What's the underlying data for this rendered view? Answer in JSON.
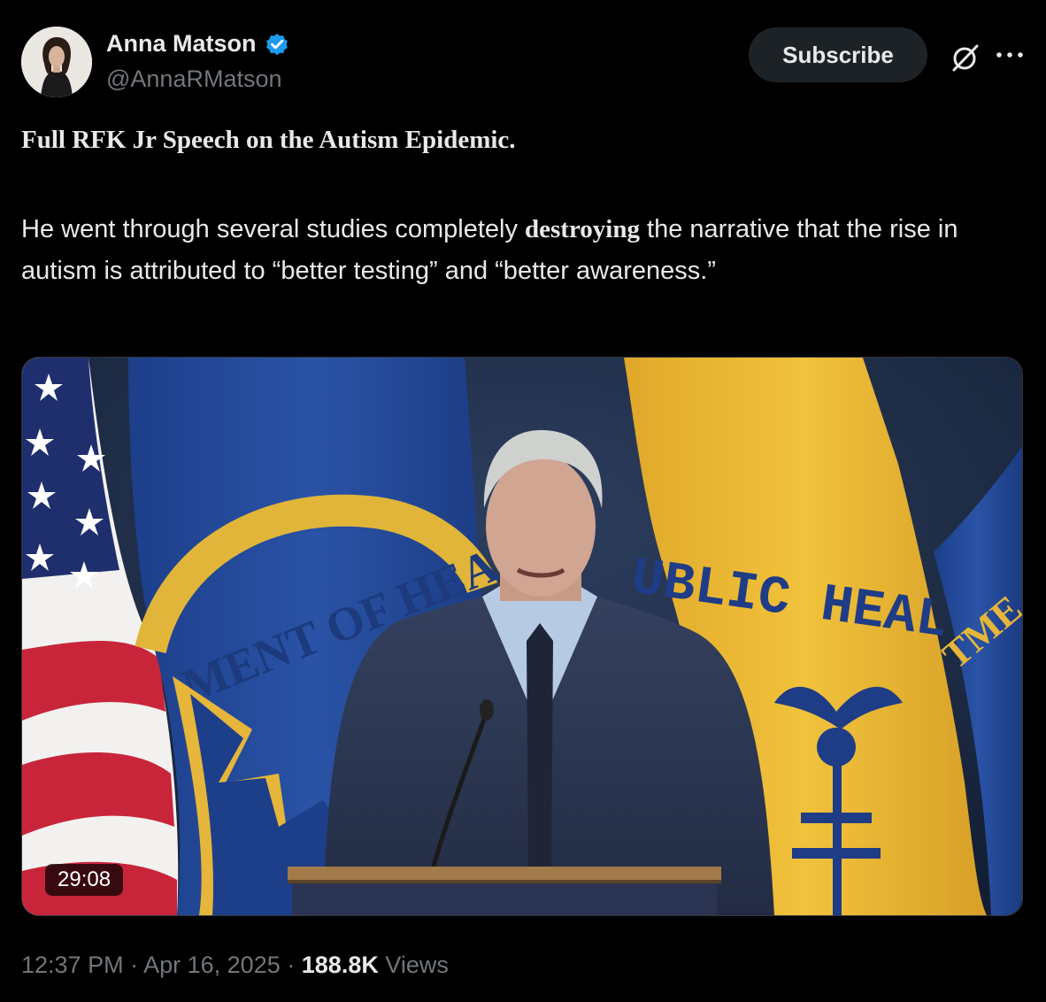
{
  "author": {
    "name": "Anna Matson",
    "handle": "@AnnaRMatson",
    "verified_color": "#1d9bf0"
  },
  "actions": {
    "subscribe_label": "Subscribe"
  },
  "post": {
    "headline": "Full RFK Jr Speech on the Autism Epidemic.",
    "body_before": "He went  through several studies completely ",
    "body_emphasis": "destroying",
    "body_after": " the narrative that the rise in autism is attributed to “better testing” and “better awareness.”"
  },
  "media": {
    "duration": "29:08",
    "banner_text_left": "MENT OF HEA",
    "banner_text_right": "UBLIC HEALTH",
    "banner_text_far_right": "TME"
  },
  "meta": {
    "time": "12:37 PM",
    "date": "Apr 16, 2025",
    "views_count": "188.8K",
    "views_label": "Views",
    "separator": "·"
  },
  "colors": {
    "background": "#000000",
    "text": "#e7e9ea",
    "muted": "#71767b",
    "accent": "#1d9bf0"
  }
}
